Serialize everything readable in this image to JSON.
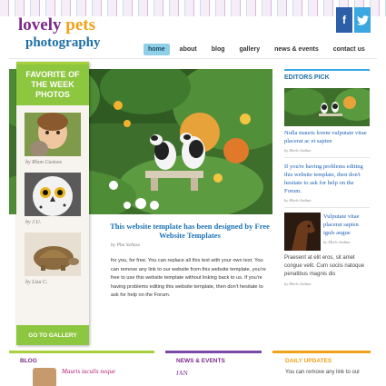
{
  "logo": {
    "word1": "lovely",
    "word2": "pets",
    "word3": "photography"
  },
  "social": {
    "facebook": "f",
    "twitter": "t"
  },
  "nav": [
    "home",
    "about",
    "blog",
    "gallery",
    "news & events",
    "contact us"
  ],
  "favorites": {
    "title": "FAVORITE OF THE WEEK PHOTOS",
    "items": [
      {
        "by": "by Rhon Custsos"
      },
      {
        "by": "by J.U."
      },
      {
        "by": "by Liza C."
      }
    ],
    "button": "GO TO GALLERY"
  },
  "post": {
    "title": "This website template has been designed by Free Website Templates",
    "byline": "by Pha Sellass",
    "body": "for you, for free. You can replace all this text with your own text. You can remove any link to our website from this website template, you're free to use this website template without linking back to us. If you're having problems editing this website template, then don't hesitate to ask for help on the Forum."
  },
  "editors": {
    "title": "EDITORS PICK",
    "item1": {
      "text": "Nulla mauris lorem vulputate vitae placerat ac et sapien",
      "by": "by Morlo Indian"
    },
    "item2": {
      "text": "If you're having problems editing this website template, then don't hesitate to ask for help on the Forum.",
      "by": "by Morlo Indian"
    },
    "item3": {
      "text": "Vulputate vitae placerat sapien iguls augue",
      "by": "by Morlo Indian"
    },
    "item4": {
      "text": "Praesent at elit eros, sit amet congue velit. Cum sociis natoque penatibus magnis dis",
      "by": "by Morlo Indian"
    }
  },
  "bottom": {
    "blog": {
      "title": "BLOG",
      "item": "Mauris iaculis neque"
    },
    "news": {
      "title": "NEWS & EVENTS",
      "item": "JAN"
    },
    "updates": {
      "title": "DAILY UPDATES",
      "item": "You can remove any link to our"
    }
  }
}
